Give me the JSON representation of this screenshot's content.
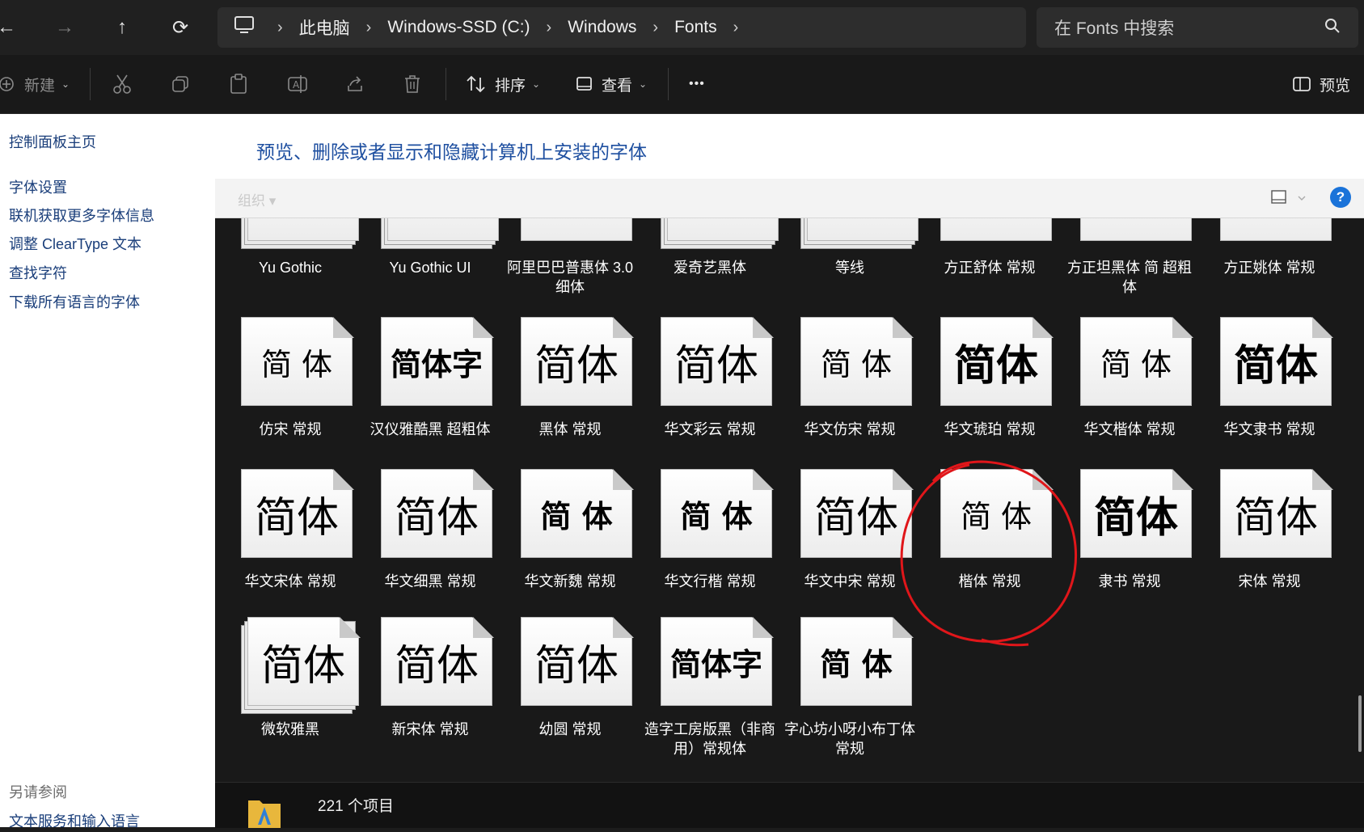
{
  "nav": {
    "back": "←",
    "forward": "→",
    "up": "↑",
    "refresh": "⟳"
  },
  "address": {
    "crumbs": [
      "此电脑",
      "Windows-SSD (C:)",
      "Windows",
      "Fonts"
    ]
  },
  "search": {
    "placeholder": "在 Fonts 中搜索"
  },
  "toolbar": {
    "new_label": "新建",
    "sort_label": "排序",
    "view_label": "查看",
    "more_label": "•••",
    "preview_label": "预览"
  },
  "sidebar": {
    "home": "控制面板主页",
    "links": [
      "字体设置",
      "联机获取更多字体信息",
      "调整 ClearType 文本",
      "查找字符",
      "下载所有语言的字体"
    ],
    "see_also_title": "另请参阅",
    "see_also": [
      "文本服务和输入语言"
    ]
  },
  "main": {
    "heading": "预览、删除或者显示和隐藏计算机上安装的字体",
    "organize": "组织 ▾",
    "help": "?"
  },
  "fonts_row0": [
    {
      "name": "Yu Gothic",
      "stack": true
    },
    {
      "name": "Yu Gothic UI",
      "stack": true
    },
    {
      "name": "阿里巴巴普惠体 3.0 细体",
      "stack": false
    },
    {
      "name": "爱奇艺黑体",
      "stack": true
    },
    {
      "name": "等线",
      "stack": true
    },
    {
      "name": "方正舒体 常规",
      "stack": false
    },
    {
      "name": "方正坦黑体 简 超粗体",
      "stack": false
    },
    {
      "name": "方正姚体 常规",
      "stack": false
    }
  ],
  "fonts": [
    {
      "name": "仿宋 常规",
      "sample": "简 体",
      "stack": false,
      "weight": "normal",
      "family": "serif"
    },
    {
      "name": "汉仪雅酷黑 超粗体",
      "sample": "简体字",
      "stack": false,
      "weight": "bold",
      "family": "sans-serif"
    },
    {
      "name": "黑体 常规",
      "sample": "简体",
      "stack": false,
      "weight": "normal",
      "family": "sans-serif"
    },
    {
      "name": "华文彩云 常规",
      "sample": "简体",
      "stack": false,
      "weight": "normal",
      "family": "sans-serif"
    },
    {
      "name": "华文仿宋 常规",
      "sample": "简 体",
      "stack": false,
      "weight": "normal",
      "family": "serif"
    },
    {
      "name": "华文琥珀 常规",
      "sample": "简体",
      "stack": false,
      "weight": "bold",
      "family": "sans-serif"
    },
    {
      "name": "华文楷体 常规",
      "sample": "简 体",
      "stack": false,
      "weight": "normal",
      "family": "serif"
    },
    {
      "name": "华文隶书 常规",
      "sample": "简体",
      "stack": false,
      "weight": "bold",
      "family": "serif"
    },
    {
      "name": "华文宋体 常规",
      "sample": "简体",
      "stack": false,
      "weight": "normal",
      "family": "serif"
    },
    {
      "name": "华文细黑 常规",
      "sample": "简体",
      "stack": false,
      "weight": "normal",
      "family": "sans-serif"
    },
    {
      "name": "华文新魏 常规",
      "sample": "简 体",
      "stack": false,
      "weight": "bold",
      "family": "serif"
    },
    {
      "name": "华文行楷 常规",
      "sample": "简 体",
      "stack": false,
      "weight": "bold",
      "family": "serif"
    },
    {
      "name": "华文中宋 常规",
      "sample": "简体",
      "stack": false,
      "weight": "normal",
      "family": "serif"
    },
    {
      "name": "楷体 常规",
      "sample": "简 体",
      "stack": false,
      "weight": "normal",
      "family": "serif"
    },
    {
      "name": "隶书 常规",
      "sample": "简体",
      "stack": false,
      "weight": "bold",
      "family": "serif"
    },
    {
      "name": "宋体 常规",
      "sample": "简体",
      "stack": false,
      "weight": "normal",
      "family": "serif"
    },
    {
      "name": "微软雅黑",
      "sample": "简体",
      "stack": true,
      "weight": "normal",
      "family": "sans-serif"
    },
    {
      "name": "新宋体 常规",
      "sample": "简体",
      "stack": false,
      "weight": "normal",
      "family": "serif"
    },
    {
      "name": "幼圆 常规",
      "sample": "简体",
      "stack": false,
      "weight": "normal",
      "family": "sans-serif"
    },
    {
      "name": "造字工房版黑（非商用）常规体",
      "sample": "简体字",
      "stack": false,
      "weight": "bold",
      "family": "sans-serif"
    },
    {
      "name": "字心坊小呀小布丁体 常规",
      "sample": "简 体",
      "stack": false,
      "weight": "bold",
      "family": "sans-serif"
    }
  ],
  "status": {
    "count": "221 个项目"
  },
  "colors": {
    "link": "#1a3e7a",
    "heading": "#1e4fa0",
    "annotation": "#e0161a"
  }
}
